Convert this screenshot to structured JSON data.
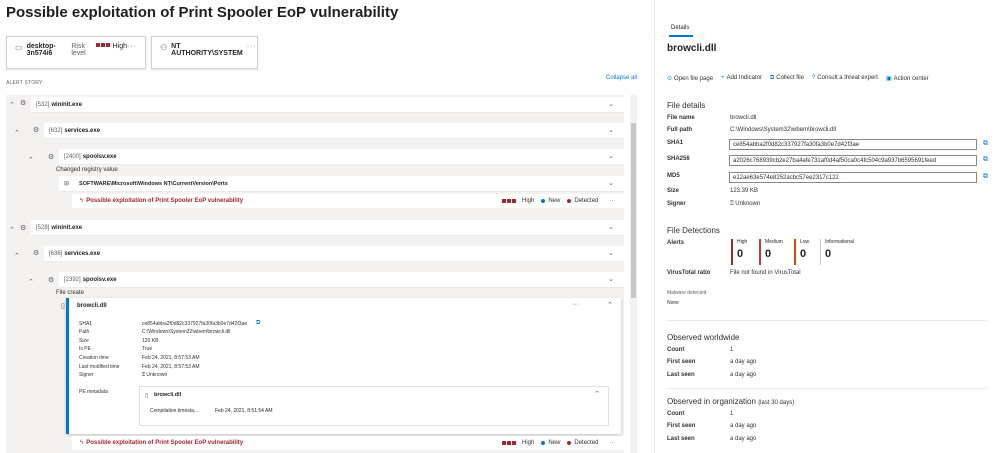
{
  "title": "Possible exploitation of Print Spooler EoP vulnerability",
  "cards": [
    {
      "name": "desktop-3n574i6",
      "risk_label": "Risk level",
      "risk_value": "High",
      "more": "···"
    },
    {
      "name": "NT AUTHORITY\\SYSTEM",
      "more": "···"
    }
  ],
  "alert_story_label": "ALERT STORY",
  "collapse_all": "Collapse all",
  "tree": {
    "p1": {
      "pid": "[532]",
      "name": "wininit.exe"
    },
    "p2": {
      "pid": "[632]",
      "name": "services.exe"
    },
    "p3": {
      "pid": "[2400]",
      "name": "spoolsv.exe"
    },
    "changed_registry": "Changed registry value",
    "registry_key": "SOFTWARE\\Microsoft\\Windows NT\\CurrentVersion\\Ports",
    "alert": {
      "text": "Possible exploitation of Print Spooler EoP vulnerability",
      "severity": "High",
      "status": "New",
      "detection": "Detected"
    },
    "p4": {
      "pid": "[528]",
      "name": "wininit.exe"
    },
    "p5": {
      "pid": "[636]",
      "name": "services.exe"
    },
    "p6": {
      "pid": "[2392]",
      "name": "spoolsv.exe"
    },
    "file_create": "File create",
    "file": {
      "name": "browcli.dll",
      "fields": [
        {
          "k": "SHA1",
          "v": "ce854abba2f0d82c337927fa30fa3b0e7d42f3ae"
        },
        {
          "k": "Path",
          "v": "C:\\Windows\\System32\\wbem\\browcli.dll"
        },
        {
          "k": "Size",
          "v": "120 KB"
        },
        {
          "k": "Is PE",
          "v": "True"
        },
        {
          "k": "Creation time",
          "v": "Feb 24, 2021, 8:57:53 AM"
        },
        {
          "k": "Last modified time",
          "v": "Feb 24, 2021, 8:57:53 AM"
        },
        {
          "k": "Signer",
          "v": "Unknown"
        }
      ],
      "pe_metadata_label": "PE metadata",
      "pe_name": "browcli.dll",
      "compilation_label": "Compilation timesta...",
      "compilation_value": "Feb 24, 2021, 8:51:54 AM"
    }
  },
  "details": {
    "tab": "Details",
    "title": "browcli.dll",
    "actions": [
      "Open file page",
      "Add Indicator",
      "Collect file",
      "Consult a threat expert",
      "Action center"
    ],
    "file_details_heading": "File details",
    "file_name_label": "File name",
    "file_name": "browcli.dll",
    "full_path_label": "Full path",
    "full_path": "C:\\Windows\\System32\\wbem\\browcli.dll",
    "sha1_label": "SHA1",
    "sha1": "ce854abba2f0d82c337927fa30fa3b0e7d42f3ae",
    "sha256_label": "SHA256",
    "sha256": "a2026c768939cb2e27ba4afe731af0d4af50ca0c4fc504c9a937b6595691feed",
    "md5_label": "MD5",
    "md5": "e12ae63e574e8252acbc57ee2317c122",
    "size_label": "Size",
    "size": "123.39 KB",
    "signer_label": "Signer",
    "signer": "Unknown",
    "detections_heading": "File Detections",
    "alerts_label": "Alerts",
    "alert_counts": [
      {
        "label": "High",
        "value": "0",
        "color": "#a4262c"
      },
      {
        "label": "Medium",
        "value": "0",
        "color": "#d13438"
      },
      {
        "label": "Low",
        "value": "0",
        "color": "#ca5010"
      },
      {
        "label": "Informational",
        "value": "0",
        "color": "#8a8886"
      }
    ],
    "vt_label": "VirusTotal ratio",
    "vt_value": "File not found in VirusTotal",
    "malware_label": "Malware detected",
    "malware_value": "None",
    "worldwide_heading": "Observed worldwide",
    "ww_count_label": "Count",
    "ww_count": "1",
    "ww_first_label": "First seen",
    "ww_first": "a day ago",
    "ww_last_label": "Last seen",
    "ww_last": "a day ago",
    "org_heading": "Observed in organization",
    "org_sub": "(last 30 days)",
    "org_count_label": "Count",
    "org_count": "1",
    "org_first_label": "First seen",
    "org_first": "a day ago",
    "org_last_label": "Last seen",
    "org_last": "a day ago"
  }
}
